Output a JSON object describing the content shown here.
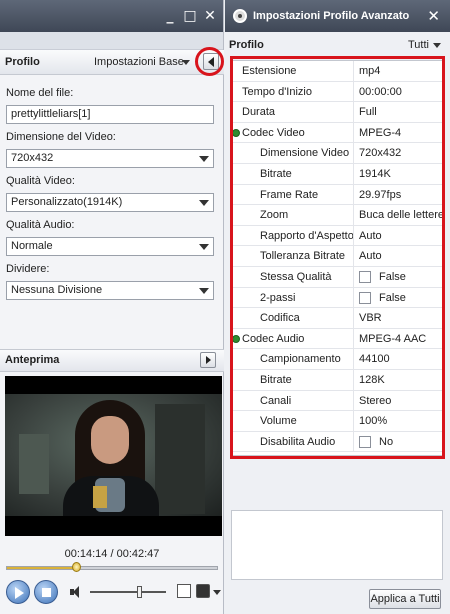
{
  "left_window": {
    "controls": {
      "minimize": "_",
      "maximize": "□",
      "close": "✕"
    },
    "profile_label": "Profilo",
    "profile_mode": "Impostazioni Base",
    "fields": {
      "file_name_label": "Nome del file:",
      "file_name_value": "prettylittleliars[1]",
      "video_size_label": "Dimensione del Video:",
      "video_size_value": "720x432",
      "video_quality_label": "Qualità Video:",
      "video_quality_value": "Personalizzato(1914K)",
      "audio_quality_label": "Qualità Audio:",
      "audio_quality_value": "Normale",
      "split_label": "Dividere:",
      "split_value": "Nessuna Divisione"
    },
    "preview": {
      "label": "Anteprima",
      "timecode": "00:14:14 / 00:42:47",
      "seek_progress": 0.333,
      "volume_level": 0.65
    }
  },
  "right_window": {
    "title": "Impostazioni Profilo Avanzato",
    "close": "✕",
    "profile_label": "Profilo",
    "filter_value": "Tutti",
    "rows": [
      {
        "name": "Estensione",
        "value": "mp4",
        "kind": "plain"
      },
      {
        "name": "Tempo d'Inizio",
        "value": "00:00:00",
        "kind": "plain"
      },
      {
        "name": "Durata",
        "value": "Full",
        "kind": "plain"
      },
      {
        "name": "Codec Video",
        "value": "MPEG-4",
        "kind": "group"
      },
      {
        "name": "Dimensione Video",
        "value": "720x432",
        "kind": "sub"
      },
      {
        "name": "Bitrate",
        "value": "1914K",
        "kind": "sub"
      },
      {
        "name": "Frame Rate",
        "value": "29.97fps",
        "kind": "sub"
      },
      {
        "name": "Zoom",
        "value": "Buca delle lettere",
        "kind": "sub"
      },
      {
        "name": "Rapporto d'Aspetto",
        "value": "Auto",
        "kind": "sub"
      },
      {
        "name": "Tolleranza Bitrate",
        "value": "Auto",
        "kind": "sub"
      },
      {
        "name": "Stessa Qualità",
        "value": "False",
        "kind": "check"
      },
      {
        "name": "2-passi",
        "value": "False",
        "kind": "check"
      },
      {
        "name": "Codifica",
        "value": "VBR",
        "kind": "sub"
      },
      {
        "name": "Codec Audio",
        "value": "MPEG-4 AAC",
        "kind": "group"
      },
      {
        "name": "Campionamento",
        "value": "44100",
        "kind": "sub"
      },
      {
        "name": "Bitrate",
        "value": "128K",
        "kind": "sub"
      },
      {
        "name": "Canali",
        "value": "Stereo",
        "kind": "sub"
      },
      {
        "name": "Volume",
        "value": "100%",
        "kind": "sub"
      },
      {
        "name": "Disabilita Audio",
        "value": "No",
        "kind": "check"
      }
    ],
    "apply_button": "Applica a Tutti"
  },
  "colors": {
    "highlight": "#d8141c",
    "titlebar": "#4a5363",
    "seek_fill": "#d9b23a"
  }
}
